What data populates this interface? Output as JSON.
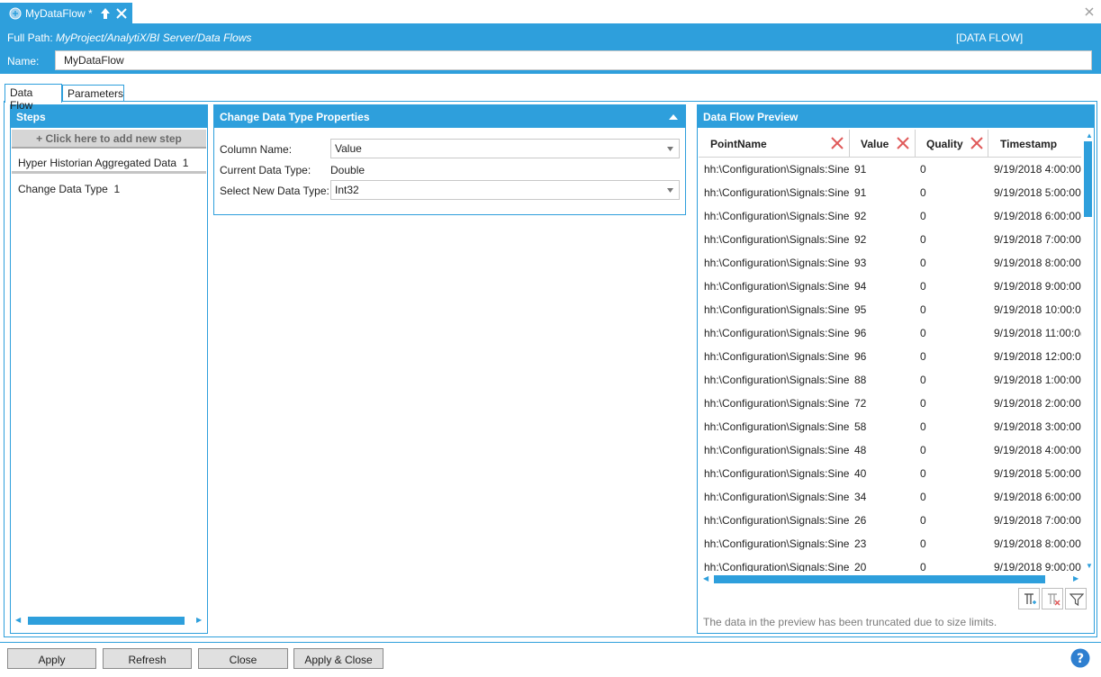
{
  "document_tab": {
    "title": "MyDataFlow *"
  },
  "header": {
    "full_path_label": "Full Path:",
    "full_path_value": "MyProject/AnalytiX/BI Server/Data Flows",
    "type_tag": "[DATA FLOW]",
    "name_label": "Name:",
    "name_value": "MyDataFlow"
  },
  "view_tabs": [
    {
      "label": "Data Flow",
      "active": true
    },
    {
      "label": "Parameters",
      "active": false
    }
  ],
  "steps": {
    "title": "Steps",
    "add_label": "+ Click here to add new step",
    "items": [
      {
        "label": "Hyper Historian Aggregated Data",
        "count": "1"
      },
      {
        "label": "Change Data Type",
        "count": "1"
      }
    ]
  },
  "properties": {
    "title": "Change Data Type Properties",
    "column_name_label": "Column Name:",
    "column_name_value": "Value",
    "current_type_label": "Current Data Type:",
    "current_type_value": "Double",
    "new_type_label": "Select New Data Type:",
    "new_type_value": "Int32"
  },
  "preview": {
    "title": "Data Flow Preview",
    "columns": [
      "PointName",
      "Value",
      "Quality",
      "Timestamp"
    ],
    "rows": [
      [
        "hh:\\Configuration\\Signals:Sine",
        "91",
        "0",
        "9/19/2018 4:00:00"
      ],
      [
        "hh:\\Configuration\\Signals:Sine",
        "91",
        "0",
        "9/19/2018 5:00:00"
      ],
      [
        "hh:\\Configuration\\Signals:Sine",
        "92",
        "0",
        "9/19/2018 6:00:00"
      ],
      [
        "hh:\\Configuration\\Signals:Sine",
        "92",
        "0",
        "9/19/2018 7:00:00"
      ],
      [
        "hh:\\Configuration\\Signals:Sine",
        "93",
        "0",
        "9/19/2018 8:00:00"
      ],
      [
        "hh:\\Configuration\\Signals:Sine",
        "94",
        "0",
        "9/19/2018 9:00:00"
      ],
      [
        "hh:\\Configuration\\Signals:Sine",
        "95",
        "0",
        "9/19/2018 10:00:0("
      ],
      [
        "hh:\\Configuration\\Signals:Sine",
        "96",
        "0",
        "9/19/2018 11:00:0("
      ],
      [
        "hh:\\Configuration\\Signals:Sine",
        "96",
        "0",
        "9/19/2018 12:00:0("
      ],
      [
        "hh:\\Configuration\\Signals:Sine",
        "88",
        "0",
        "9/19/2018 1:00:00"
      ],
      [
        "hh:\\Configuration\\Signals:Sine",
        "72",
        "0",
        "9/19/2018 2:00:00"
      ],
      [
        "hh:\\Configuration\\Signals:Sine",
        "58",
        "0",
        "9/19/2018 3:00:00"
      ],
      [
        "hh:\\Configuration\\Signals:Sine",
        "48",
        "0",
        "9/19/2018 4:00:00"
      ],
      [
        "hh:\\Configuration\\Signals:Sine",
        "40",
        "0",
        "9/19/2018 5:00:00"
      ],
      [
        "hh:\\Configuration\\Signals:Sine",
        "34",
        "0",
        "9/19/2018 6:00:00"
      ],
      [
        "hh:\\Configuration\\Signals:Sine",
        "26",
        "0",
        "9/19/2018 7:00:00"
      ],
      [
        "hh:\\Configuration\\Signals:Sine",
        "23",
        "0",
        "9/19/2018 8:00:00"
      ],
      [
        "hh:\\Configuration\\Signals:Sine",
        "20",
        "0",
        "9/19/2018 9:00:00"
      ]
    ],
    "truncated_note": "The data in the preview has been truncated due to size limits."
  },
  "footer": {
    "apply_label": "Apply",
    "refresh_label": "Refresh",
    "close_label": "Close",
    "apply_close_label": "Apply & Close"
  },
  "icons": {
    "tab": "dataflow-icon",
    "pin": "pin-icon",
    "close": "close-icon",
    "remove_column": "remove-column-icon",
    "help": "help-icon",
    "filter": "filter-icon"
  },
  "colors": {
    "accent": "#2e9fdc",
    "remove_red": "#e05a5a"
  }
}
